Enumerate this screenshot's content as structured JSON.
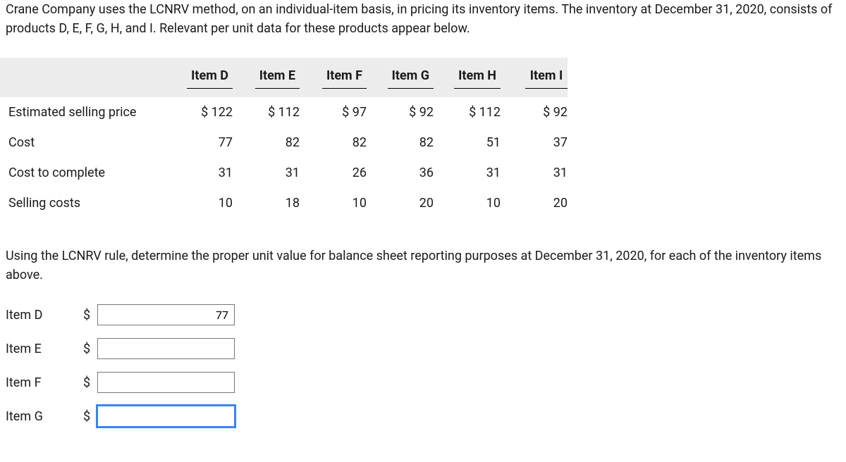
{
  "intro": "Crane Company uses the LCNRV method, on an individual-item basis, in pricing its inventory items. The inventory at December 31, 2020, consists of products D, E, F, G, H, and I. Relevant per unit data for these products appear below.",
  "table": {
    "columns": [
      "Item D",
      "Item E",
      "Item F",
      "Item G",
      "Item H",
      "Item I"
    ],
    "rows": [
      {
        "label": "Estimated selling price",
        "values": [
          "$ 122",
          "$ 112",
          "$ 97",
          "$ 92",
          "$ 112",
          "$ 92"
        ]
      },
      {
        "label": "Cost",
        "values": [
          "77",
          "82",
          "82",
          "82",
          "51",
          "37"
        ]
      },
      {
        "label": "Cost to complete",
        "values": [
          "31",
          "31",
          "26",
          "36",
          "31",
          "31"
        ]
      },
      {
        "label": "Selling costs",
        "values": [
          "10",
          "18",
          "10",
          "20",
          "10",
          "20"
        ]
      }
    ]
  },
  "question": "Using the LCNRV rule, determine the proper unit value for balance sheet reporting purposes at December 31, 2020, for each of the inventory items above.",
  "answers": [
    {
      "label": "Item D",
      "currency": "$",
      "value": "77"
    },
    {
      "label": "Item E",
      "currency": "$",
      "value": ""
    },
    {
      "label": "Item F",
      "currency": "$",
      "value": ""
    },
    {
      "label": "Item G",
      "currency": "$",
      "value": ""
    }
  ]
}
